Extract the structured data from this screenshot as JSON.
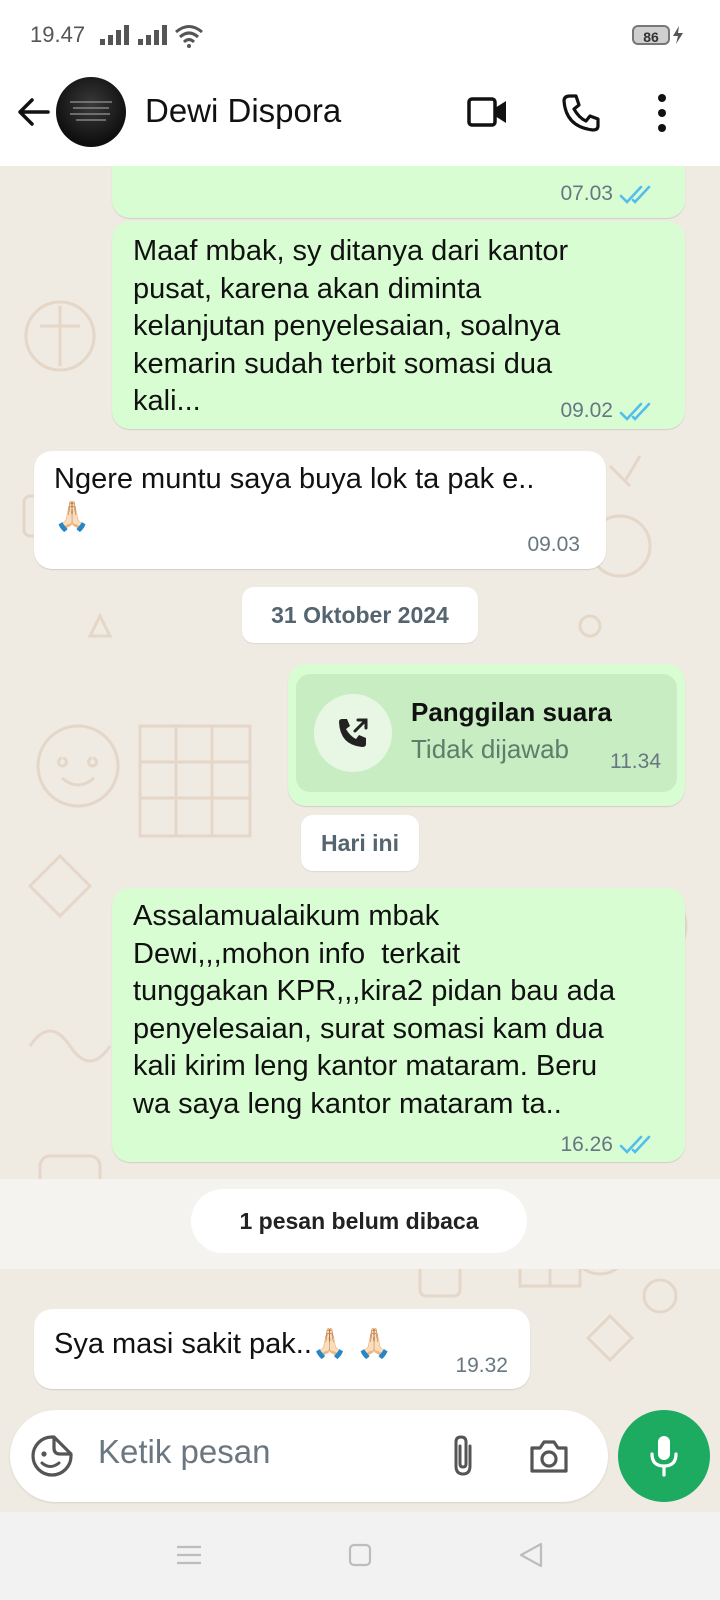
{
  "status_bar": {
    "time": "19.47",
    "battery": "86"
  },
  "header": {
    "contact_name": "Dewi Dispora",
    "icons": [
      "back-arrow-icon",
      "video-call-icon",
      "voice-call-icon",
      "more-options-icon"
    ]
  },
  "messages": [
    {
      "direction": "out",
      "text": "",
      "time": "07.03",
      "status": "read"
    },
    {
      "direction": "out",
      "text": "Maaf mbak, sy ditanya dari kantor\npusat, karena akan diminta\nkelanjutan penyelesaian, soalnya\nkemarin sudah terbit somasi dua\nkali...",
      "time": "09.02",
      "status": "read"
    },
    {
      "direction": "in",
      "text": "Ngere muntu saya buya lok ta pak e..\n🙏🏻",
      "time": "09.03"
    },
    {
      "direction": "out",
      "type": "call",
      "call_title": "Panggilan suara",
      "call_status": "Tidak dijawab",
      "time": "11.34"
    },
    {
      "direction": "out",
      "text": "Assalamualaikum mbak\nDewi,,,mohon info  terkait\ntunggakan KPR,,,kira2 pidan bau ada\npenyelesaian, surat somasi kam dua\nkali kirim leng kantor mataram. Beru\nwa saya leng kantor mataram ta..",
      "time": "16.26",
      "status": "read"
    },
    {
      "direction": "in",
      "text": "Sya masi sakit pak..🙏🏻 🙏🏻",
      "time": "19.32"
    }
  ],
  "date_chips": [
    "31 Oktober 2024",
    "Hari ini"
  ],
  "unread_banner": "1 pesan belum dibaca",
  "composer": {
    "placeholder": "Ketik pesan"
  },
  "colors": {
    "outgoing_bubble": "#d9fdd3",
    "incoming_bubble": "#ffffff",
    "chat_background": "#efeae2",
    "read_ticks": "#53bdeb",
    "mic_button": "#1daa61"
  }
}
